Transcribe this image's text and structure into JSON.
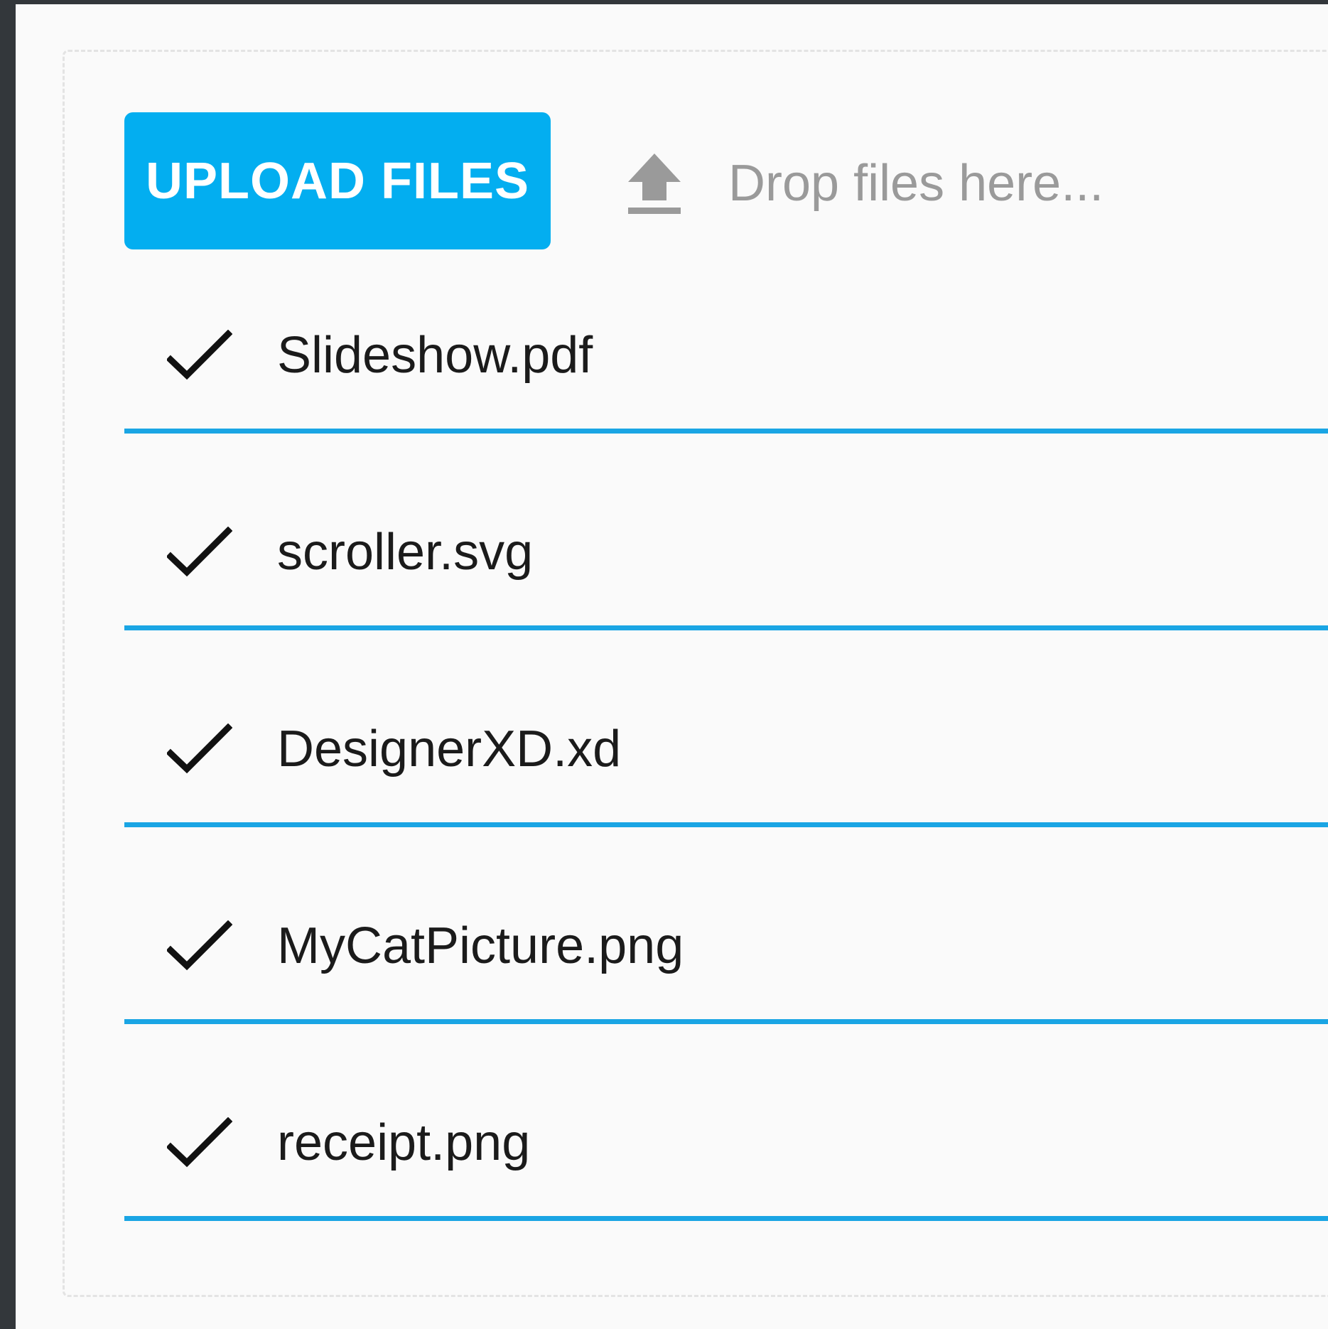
{
  "colors": {
    "accent": "#03aef0",
    "progress": "#1aa5e4",
    "hint_text": "#9a9a9a",
    "file_text": "#1b1b1b",
    "frame": "#33373b"
  },
  "uploader": {
    "upload_button_label": "UPLOAD FILES",
    "drop_hint": "Drop files here...",
    "upload_icon": "upload-arrow-icon"
  },
  "files": [
    {
      "name": "Slideshow.pdf",
      "status_icon": "checkmark-icon",
      "progress": 1.0
    },
    {
      "name": "scroller.svg",
      "status_icon": "checkmark-icon",
      "progress": 1.0
    },
    {
      "name": "DesignerXD.xd",
      "status_icon": "checkmark-icon",
      "progress": 1.0
    },
    {
      "name": "MyCatPicture.png",
      "status_icon": "checkmark-icon",
      "progress": 1.0
    },
    {
      "name": "receipt.png",
      "status_icon": "checkmark-icon",
      "progress": 1.0
    }
  ]
}
